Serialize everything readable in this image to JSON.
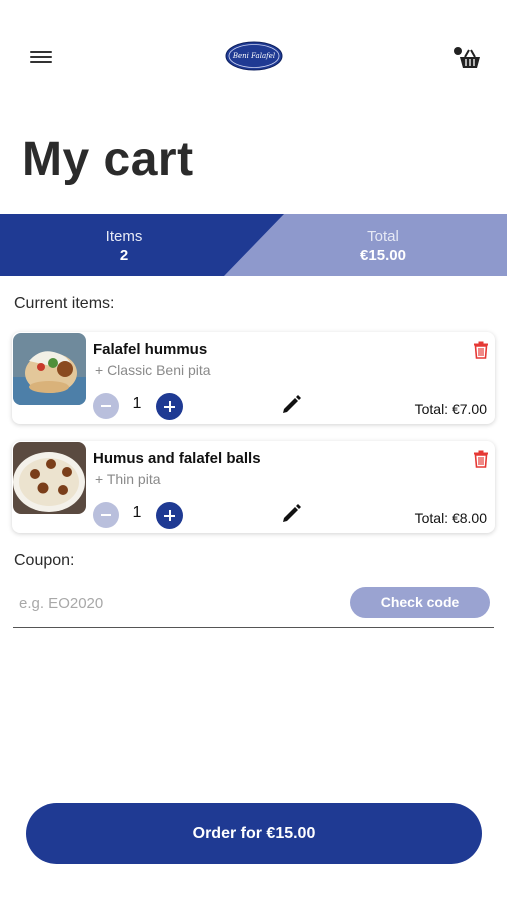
{
  "header": {
    "logo_text": "Beni Falafel",
    "menu_icon": "hamburger-menu-icon",
    "cart_icon": "basket-icon"
  },
  "title": "My cart",
  "summary": {
    "items_label": "Items",
    "items_value": "2",
    "total_label": "Total",
    "total_value": "€15.00"
  },
  "current_items_label": "Current items:",
  "cart_items": [
    {
      "name": "Falafel hummus",
      "option": "+ Classic Beni pita",
      "quantity": "1",
      "total": "Total: €7.00",
      "image": "falafel-pita-photo"
    },
    {
      "name": "Humus and falafel balls",
      "option": "+ Thin pita",
      "quantity": "1",
      "total": "Total: €8.00",
      "image": "hummus-plate-photo"
    }
  ],
  "coupon": {
    "label": "Coupon:",
    "placeholder": "e.g. EO2020",
    "value": "",
    "check_label": "Check code"
  },
  "order_button": "Order for €15.00",
  "colors": {
    "primary": "#1f3a93",
    "primary_light": "#9aa3d1",
    "summary_right": "#8e99cc",
    "delete": "#e53935"
  }
}
